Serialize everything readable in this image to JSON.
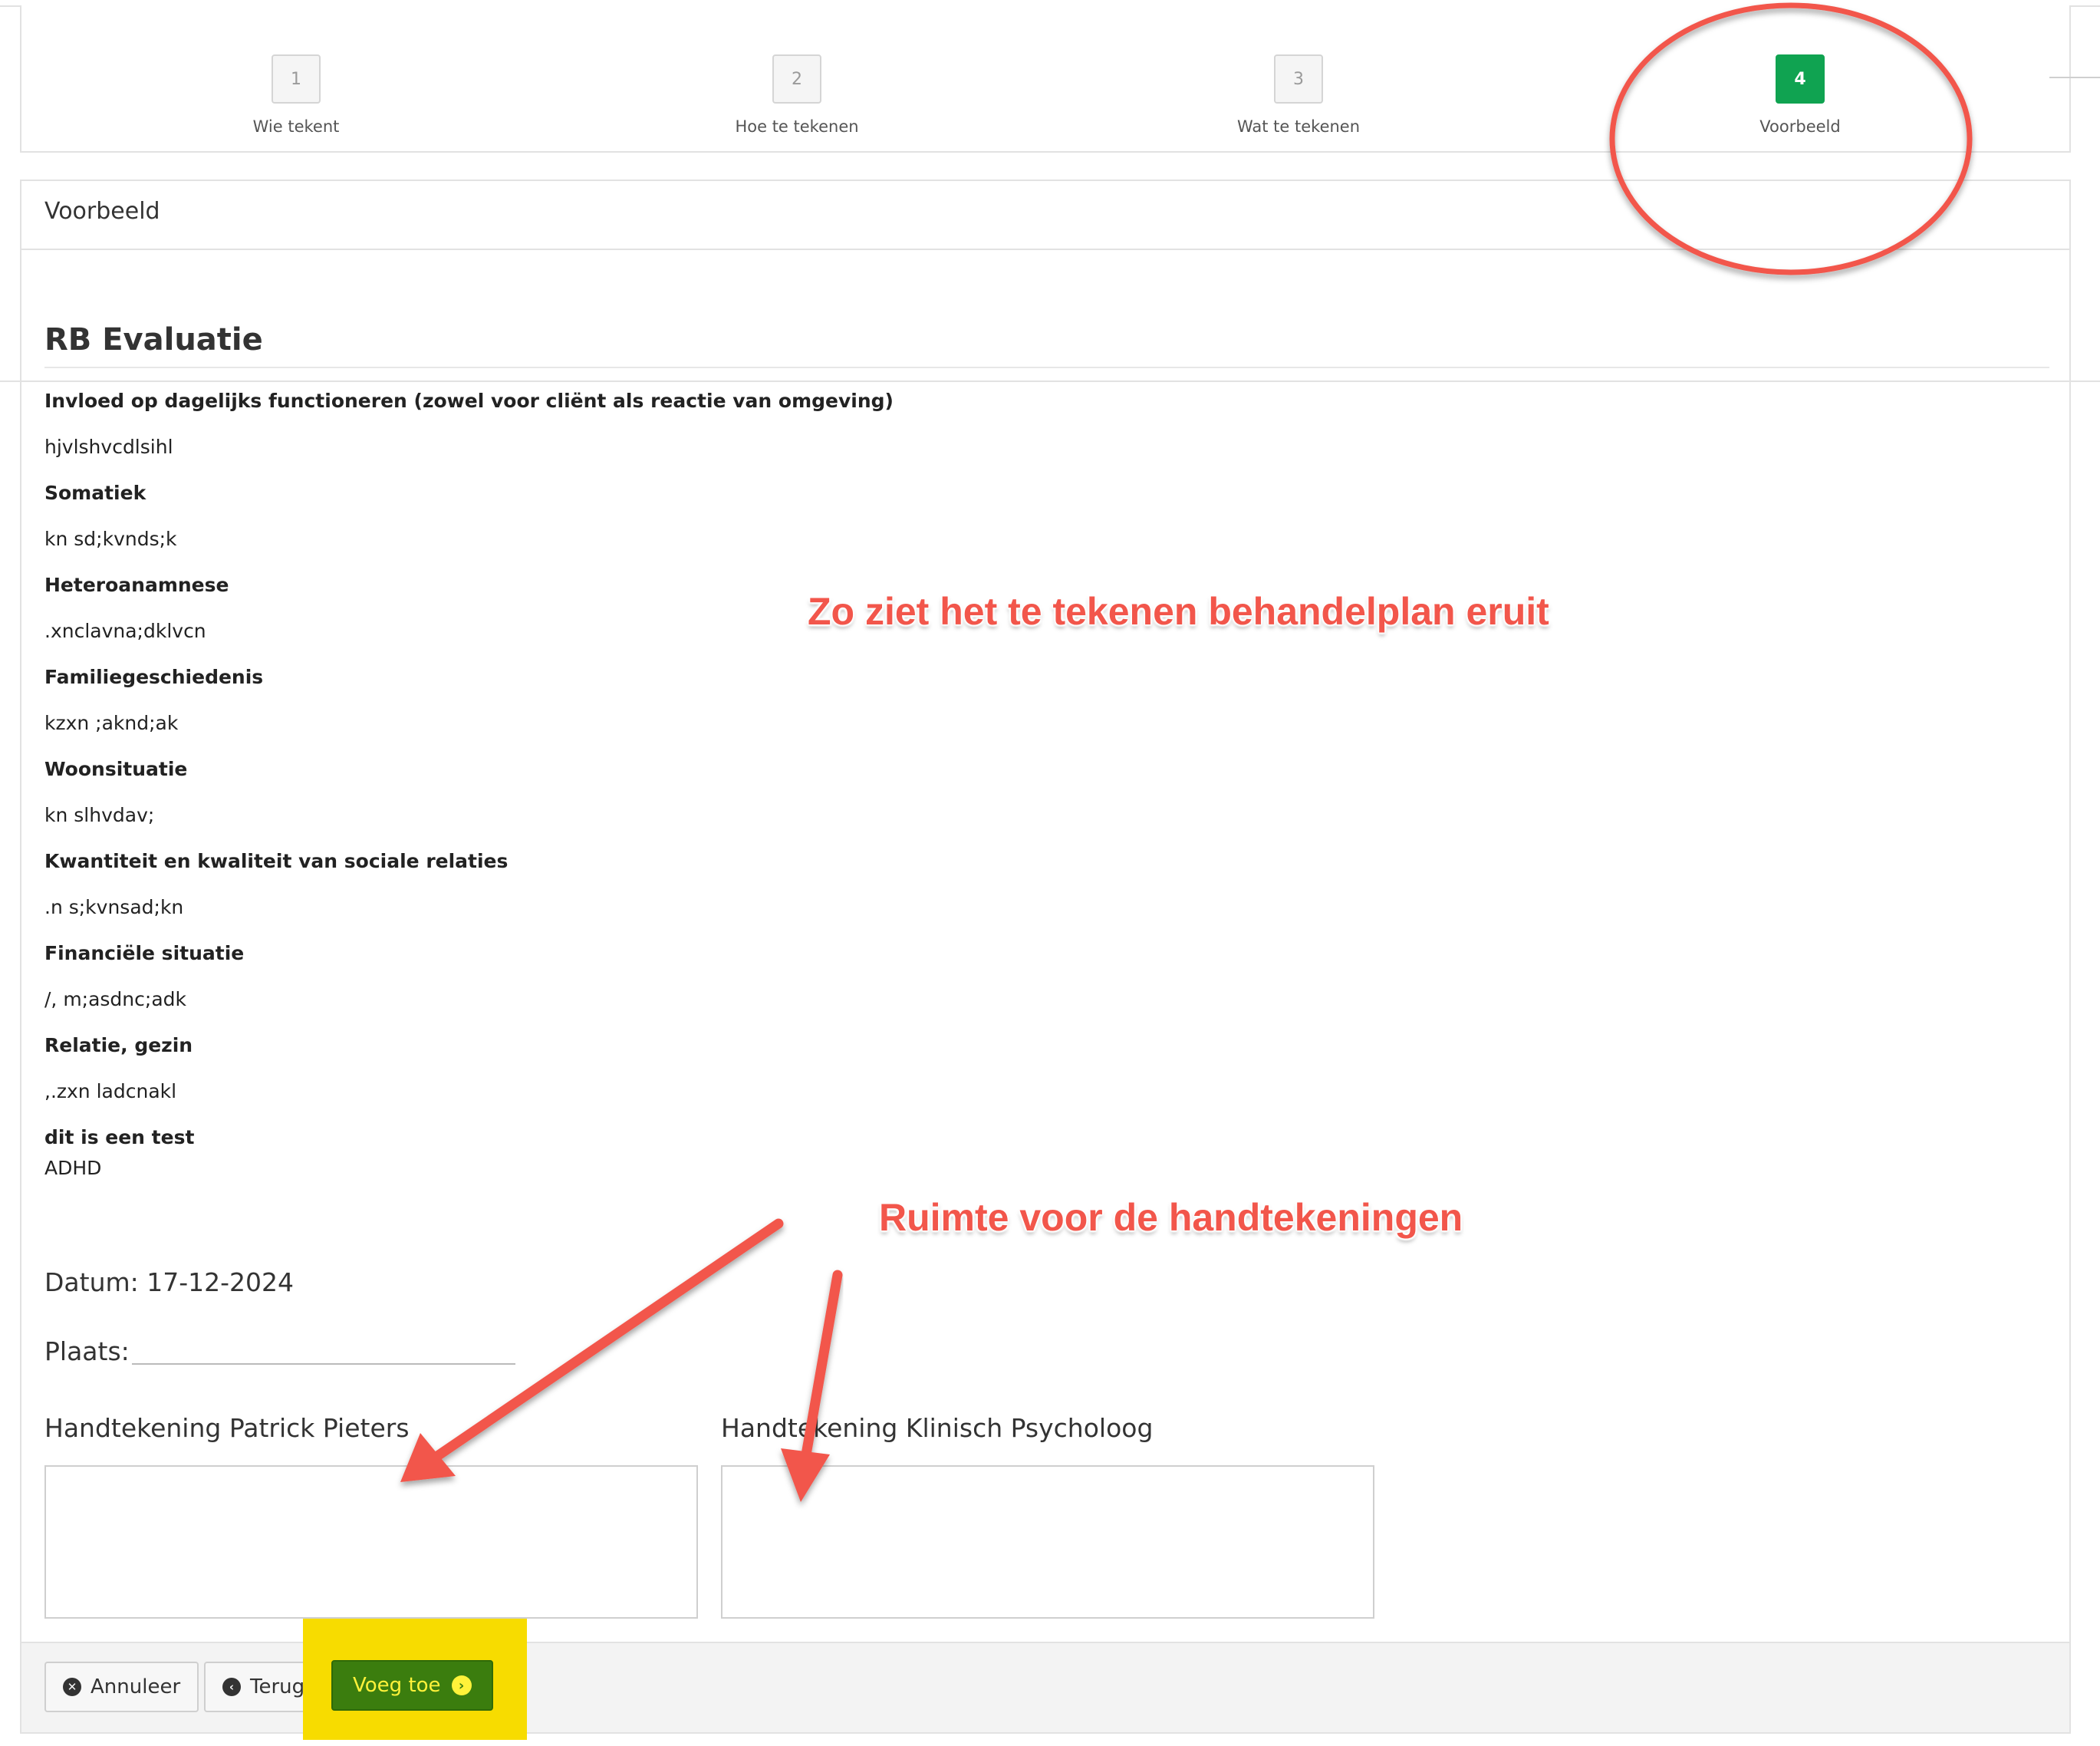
{
  "wizard": {
    "steps": [
      {
        "number": "1",
        "label": "Wie tekent",
        "active": false
      },
      {
        "number": "2",
        "label": "Hoe te tekenen",
        "active": false
      },
      {
        "number": "3",
        "label": "Wat te tekenen",
        "active": false
      },
      {
        "number": "4",
        "label": "Voorbeeld",
        "active": true
      }
    ]
  },
  "panel": {
    "title": "Voorbeeld"
  },
  "document": {
    "title": "RB Evaluatie",
    "fields": [
      {
        "label": "Invloed op dagelijks functioneren (zowel voor cliënt als reactie van omgeving)",
        "value": "hjvlshvcdlsihl"
      },
      {
        "label": "Somatiek",
        "value": "kn sd;kvnds;k"
      },
      {
        "label": "Heteroanamnese",
        "value": ".xnclavna;dklvcn"
      },
      {
        "label": "Familiegeschiedenis",
        "value": "kzxn ;aknd;ak"
      },
      {
        "label": "Woonsituatie",
        "value": "kn slhvdav;"
      },
      {
        "label": "Kwantiteit en kwaliteit van sociale relaties",
        "value": ".n s;kvnsad;kn"
      },
      {
        "label": "Financiële situatie",
        "value": "/, m;asdnc;adk"
      },
      {
        "label": "Relatie, gezin",
        "value": ",.zxn ladcnakl"
      },
      {
        "label": "dit is een test",
        "value": "ADHD"
      }
    ],
    "datum": "Datum: 17-12-2024",
    "plaats": "Plaats:",
    "signatures": [
      {
        "label": "Handtekening Patrick Pieters"
      },
      {
        "label": "Handtekening Klinisch Psycholoog"
      }
    ]
  },
  "footer": {
    "cancel_label": "Annuleer",
    "back_label": "Terug",
    "add_label": "Voeg toe"
  },
  "annotations": {
    "preview_note": "Zo ziet het te tekenen behandelplan eruit",
    "signature_note": "Ruimte voor de handtekeningen",
    "color": "#f2564b",
    "highlight_color": "#f7dc00"
  },
  "colors": {
    "active_step": "#10a351",
    "primary_button": "#3b7d0e"
  }
}
